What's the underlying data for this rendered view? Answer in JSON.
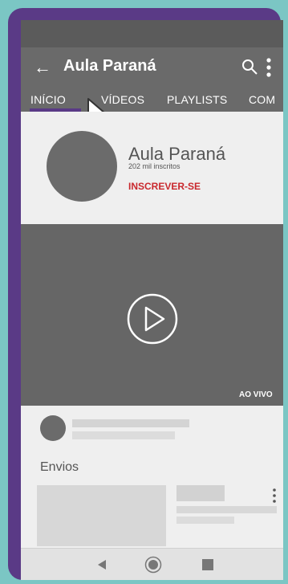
{
  "appbar": {
    "back_icon": "arrow-left-icon",
    "title": "Aula Paraná",
    "search_icon": "search-icon",
    "more_icon": "more-vertical-icon"
  },
  "tabs": [
    {
      "label": "INÍCIO",
      "active": true
    },
    {
      "label": "VÍDEOS",
      "active": false
    },
    {
      "label": "PLAYLISTS",
      "active": false
    },
    {
      "label": "COM",
      "active": false
    }
  ],
  "channel": {
    "name": "Aula Paraná",
    "subscribers": "202 mil inscritos",
    "subscribe_label": "INSCREVER-SE",
    "subscribe_color": "#c9282d"
  },
  "video": {
    "live_label": "AO VIVO",
    "play_icon": "play-circle-icon"
  },
  "sections": {
    "uploads_title": "Envios"
  },
  "navbar": {
    "back_icon": "triangle-back-icon",
    "home_icon": "circle-home-icon",
    "recents_icon": "square-recents-icon"
  },
  "colors": {
    "frame": "#5a3a86",
    "background": "#7bc6c4",
    "appbar": "#6a6a6a",
    "accent": "#5a3a86"
  }
}
